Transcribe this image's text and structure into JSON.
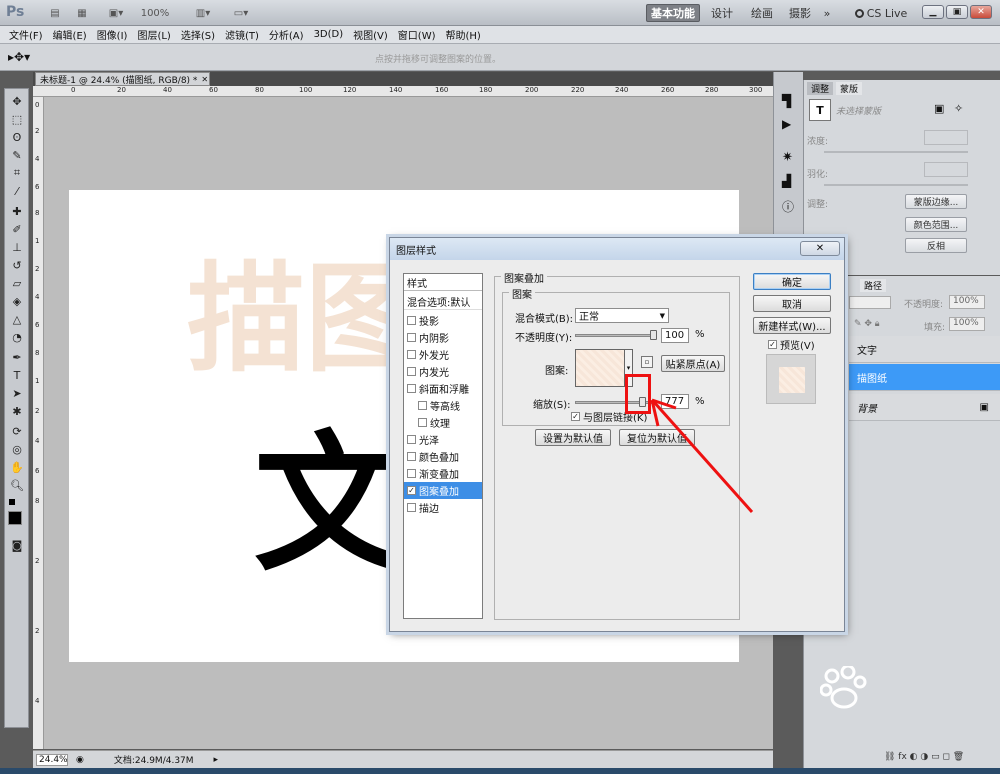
{
  "app": {
    "logo": "Ps",
    "zoom": "100%",
    "workspaces": [
      "基本功能",
      "设计",
      "绘画",
      "摄影"
    ],
    "more": "»",
    "cslive": "CS Live"
  },
  "menu": [
    "文件(F)",
    "编辑(E)",
    "图像(I)",
    "图层(L)",
    "选择(S)",
    "滤镜(T)",
    "分析(A)",
    "3D(D)",
    "视图(V)",
    "窗口(W)",
    "帮助(H)"
  ],
  "optionsbar": {
    "hint": "点按并拖移可调整图案的位置。"
  },
  "document": {
    "tab_title": "未标题-1 @ 24.4% (描图纸, RGB/8) *",
    "ruler_ticks": [
      "0",
      "20",
      "40",
      "60",
      "80",
      "100",
      "120",
      "140",
      "160",
      "180",
      "200",
      "220",
      "240",
      "260",
      "280",
      "300"
    ],
    "vruler_ticks": [
      "0",
      "2",
      "4",
      "6",
      "8",
      "1",
      "2",
      "4",
      "6",
      "8",
      "1",
      "2",
      "4",
      "6",
      "8",
      "2",
      "2",
      "4"
    ],
    "canvas_faint_text": "描图",
    "canvas_black_text": "文"
  },
  "status": {
    "zoom": "24.4%",
    "doc_info": "文档:24.9M/4.37M"
  },
  "adjust_panel": {
    "tabs": [
      "调整",
      "蒙版"
    ],
    "no_mask": "未选择蒙版",
    "density": "浓度:",
    "feather": "羽化:",
    "refine": "调整:",
    "mask_edge": "蒙版边缘...",
    "color_range": "颜色范围...",
    "invert": "反相"
  },
  "layers_panel": {
    "tabs": [
      "路径"
    ],
    "opacity_label": "不透明度:",
    "opacity": "100%",
    "fill_label": "填充:",
    "fill": "100%",
    "layers": [
      {
        "name": "文字",
        "selected": false
      },
      {
        "name": "描图纸",
        "selected": true
      },
      {
        "name": "背景",
        "selected": false
      }
    ]
  },
  "dialog": {
    "title": "图层样式",
    "close": "✕",
    "styles_header": "样式",
    "blend_options": "混合选项:默认",
    "styles": [
      {
        "label": "投影",
        "checked": false,
        "indent": false
      },
      {
        "label": "内阴影",
        "checked": false,
        "indent": false
      },
      {
        "label": "外发光",
        "checked": false,
        "indent": false
      },
      {
        "label": "内发光",
        "checked": false,
        "indent": false
      },
      {
        "label": "斜面和浮雕",
        "checked": false,
        "indent": false
      },
      {
        "label": "等高线",
        "checked": false,
        "indent": true
      },
      {
        "label": "纹理",
        "checked": false,
        "indent": true
      },
      {
        "label": "光泽",
        "checked": false,
        "indent": false
      },
      {
        "label": "颜色叠加",
        "checked": false,
        "indent": false
      },
      {
        "label": "渐变叠加",
        "checked": false,
        "indent": false
      },
      {
        "label": "图案叠加",
        "checked": true,
        "indent": false
      },
      {
        "label": "描边",
        "checked": false,
        "indent": false
      }
    ],
    "group_title": "图案叠加",
    "subgroup_title": "图案",
    "blend_mode_label": "混合模式(B):",
    "blend_mode_value": "正常",
    "opacity_label": "不透明度(Y):",
    "opacity_value": "100",
    "opacity_level": 1.0,
    "pattern_label": "图案:",
    "snap_origin": "贴紧原点(A)",
    "scale_label": "缩放(S):",
    "scale_value": "777",
    "percent": "%",
    "link_layer": "与图层链接(K)",
    "link_checked": true,
    "set_default": "设置为默认值",
    "reset_default": "复位为默认值",
    "ok": "确定",
    "cancel": "取消",
    "new_style": "新建样式(W)...",
    "preview": "预览(V)",
    "preview_checked": true
  },
  "colors": {
    "accent_blue": "#3d9af7",
    "annotation_red": "#ee1111",
    "pattern_tint": "#f7e6d9"
  }
}
